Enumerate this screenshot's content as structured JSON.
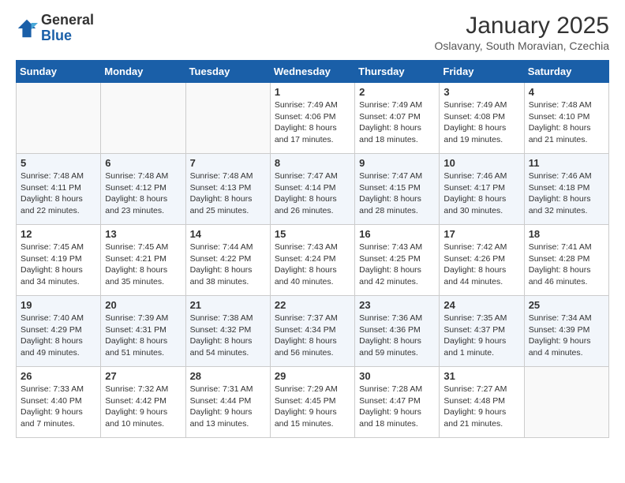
{
  "logo": {
    "general": "General",
    "blue": "Blue"
  },
  "header": {
    "month": "January 2025",
    "location": "Oslavany, South Moravian, Czechia"
  },
  "days_of_week": [
    "Sunday",
    "Monday",
    "Tuesday",
    "Wednesday",
    "Thursday",
    "Friday",
    "Saturday"
  ],
  "weeks": [
    [
      {
        "day": "",
        "info": ""
      },
      {
        "day": "",
        "info": ""
      },
      {
        "day": "",
        "info": ""
      },
      {
        "day": "1",
        "info": "Sunrise: 7:49 AM\nSunset: 4:06 PM\nDaylight: 8 hours\nand 17 minutes."
      },
      {
        "day": "2",
        "info": "Sunrise: 7:49 AM\nSunset: 4:07 PM\nDaylight: 8 hours\nand 18 minutes."
      },
      {
        "day": "3",
        "info": "Sunrise: 7:49 AM\nSunset: 4:08 PM\nDaylight: 8 hours\nand 19 minutes."
      },
      {
        "day": "4",
        "info": "Sunrise: 7:48 AM\nSunset: 4:10 PM\nDaylight: 8 hours\nand 21 minutes."
      }
    ],
    [
      {
        "day": "5",
        "info": "Sunrise: 7:48 AM\nSunset: 4:11 PM\nDaylight: 8 hours\nand 22 minutes."
      },
      {
        "day": "6",
        "info": "Sunrise: 7:48 AM\nSunset: 4:12 PM\nDaylight: 8 hours\nand 23 minutes."
      },
      {
        "day": "7",
        "info": "Sunrise: 7:48 AM\nSunset: 4:13 PM\nDaylight: 8 hours\nand 25 minutes."
      },
      {
        "day": "8",
        "info": "Sunrise: 7:47 AM\nSunset: 4:14 PM\nDaylight: 8 hours\nand 26 minutes."
      },
      {
        "day": "9",
        "info": "Sunrise: 7:47 AM\nSunset: 4:15 PM\nDaylight: 8 hours\nand 28 minutes."
      },
      {
        "day": "10",
        "info": "Sunrise: 7:46 AM\nSunset: 4:17 PM\nDaylight: 8 hours\nand 30 minutes."
      },
      {
        "day": "11",
        "info": "Sunrise: 7:46 AM\nSunset: 4:18 PM\nDaylight: 8 hours\nand 32 minutes."
      }
    ],
    [
      {
        "day": "12",
        "info": "Sunrise: 7:45 AM\nSunset: 4:19 PM\nDaylight: 8 hours\nand 34 minutes."
      },
      {
        "day": "13",
        "info": "Sunrise: 7:45 AM\nSunset: 4:21 PM\nDaylight: 8 hours\nand 35 minutes."
      },
      {
        "day": "14",
        "info": "Sunrise: 7:44 AM\nSunset: 4:22 PM\nDaylight: 8 hours\nand 38 minutes."
      },
      {
        "day": "15",
        "info": "Sunrise: 7:43 AM\nSunset: 4:24 PM\nDaylight: 8 hours\nand 40 minutes."
      },
      {
        "day": "16",
        "info": "Sunrise: 7:43 AM\nSunset: 4:25 PM\nDaylight: 8 hours\nand 42 minutes."
      },
      {
        "day": "17",
        "info": "Sunrise: 7:42 AM\nSunset: 4:26 PM\nDaylight: 8 hours\nand 44 minutes."
      },
      {
        "day": "18",
        "info": "Sunrise: 7:41 AM\nSunset: 4:28 PM\nDaylight: 8 hours\nand 46 minutes."
      }
    ],
    [
      {
        "day": "19",
        "info": "Sunrise: 7:40 AM\nSunset: 4:29 PM\nDaylight: 8 hours\nand 49 minutes."
      },
      {
        "day": "20",
        "info": "Sunrise: 7:39 AM\nSunset: 4:31 PM\nDaylight: 8 hours\nand 51 minutes."
      },
      {
        "day": "21",
        "info": "Sunrise: 7:38 AM\nSunset: 4:32 PM\nDaylight: 8 hours\nand 54 minutes."
      },
      {
        "day": "22",
        "info": "Sunrise: 7:37 AM\nSunset: 4:34 PM\nDaylight: 8 hours\nand 56 minutes."
      },
      {
        "day": "23",
        "info": "Sunrise: 7:36 AM\nSunset: 4:36 PM\nDaylight: 8 hours\nand 59 minutes."
      },
      {
        "day": "24",
        "info": "Sunrise: 7:35 AM\nSunset: 4:37 PM\nDaylight: 9 hours\nand 1 minute."
      },
      {
        "day": "25",
        "info": "Sunrise: 7:34 AM\nSunset: 4:39 PM\nDaylight: 9 hours\nand 4 minutes."
      }
    ],
    [
      {
        "day": "26",
        "info": "Sunrise: 7:33 AM\nSunset: 4:40 PM\nDaylight: 9 hours\nand 7 minutes."
      },
      {
        "day": "27",
        "info": "Sunrise: 7:32 AM\nSunset: 4:42 PM\nDaylight: 9 hours\nand 10 minutes."
      },
      {
        "day": "28",
        "info": "Sunrise: 7:31 AM\nSunset: 4:44 PM\nDaylight: 9 hours\nand 13 minutes."
      },
      {
        "day": "29",
        "info": "Sunrise: 7:29 AM\nSunset: 4:45 PM\nDaylight: 9 hours\nand 15 minutes."
      },
      {
        "day": "30",
        "info": "Sunrise: 7:28 AM\nSunset: 4:47 PM\nDaylight: 9 hours\nand 18 minutes."
      },
      {
        "day": "31",
        "info": "Sunrise: 7:27 AM\nSunset: 4:48 PM\nDaylight: 9 hours\nand 21 minutes."
      },
      {
        "day": "",
        "info": ""
      }
    ]
  ]
}
